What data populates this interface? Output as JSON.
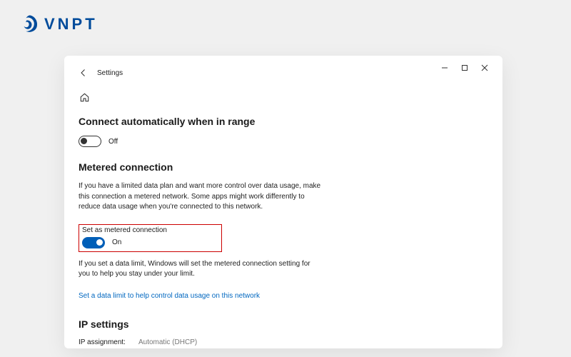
{
  "brand": {
    "text": "VNPT"
  },
  "window": {
    "title": "Settings",
    "sections": {
      "auto_connect": {
        "heading": "Connect automatically when in range",
        "toggle_state": "off",
        "toggle_label": "Off"
      },
      "metered": {
        "heading": "Metered connection",
        "description": "If you have a limited data plan and want more control over data usage, make this connection a metered network. Some apps might work differently to reduce data usage when you're connected to this network.",
        "set_label": "Set as metered connection",
        "toggle_state": "on",
        "toggle_label": "On",
        "limit_note": "If you set a data limit, Windows will set the metered connection setting for you to help you stay under your limit.",
        "link_text": "Set a data limit to help control data usage on this network"
      },
      "ip": {
        "heading": "IP settings",
        "assignment_key": "IP assignment:",
        "assignment_value": "Automatic (DHCP)"
      }
    }
  }
}
